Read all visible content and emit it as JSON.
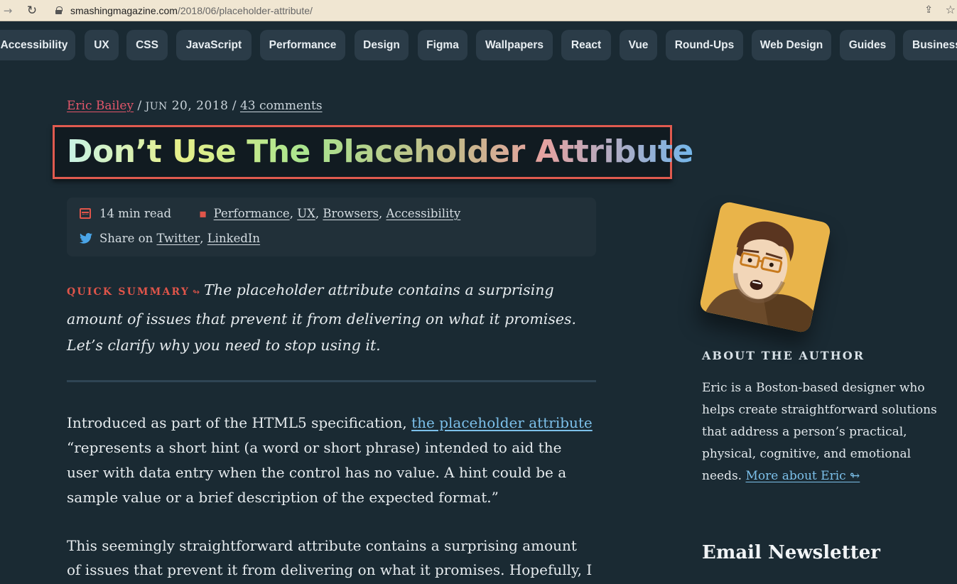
{
  "browser": {
    "back_glyph": "→",
    "reload_glyph": "↻",
    "url_host": "smashingmagazine.com",
    "url_path": "/2018/06/placeholder-attribute/",
    "share_glyph": "⇪",
    "star_glyph": "☆"
  },
  "categories": [
    "Accessibility",
    "UX",
    "CSS",
    "JavaScript",
    "Performance",
    "Design",
    "Figma",
    "Wallpapers",
    "React",
    "Vue",
    "Round-Ups",
    "Web Design",
    "Guides",
    "Business"
  ],
  "article": {
    "author": "Eric Bailey",
    "separator": "/",
    "date_month": "JUN",
    "date_rest": "20, 2018",
    "comments": "43 comments",
    "title": "Don’t Use The Placeholder Attribute",
    "read_time": "14 min read",
    "tags": [
      "Performance",
      "UX",
      "Browsers",
      "Accessibility"
    ],
    "share_prefix": "Share on",
    "share_links": [
      "Twitter",
      "LinkedIn"
    ],
    "summary_label": "QUICK SUMMARY",
    "summary_arrow": "↬",
    "summary_text": "The placeholder attribute contains a surprising amount of issues that prevent it from delivering on what it promises. Let’s clarify why you need to stop using it.",
    "p1_before": "Introduced as part of the HTML5 specification, ",
    "p1_link": "the placeholder attribute",
    "p1_after": "“represents a short hint (a word or short phrase) intended to aid the user with data entry when the control has no value. A hint could be a sample value or a brief description of the expected format.”",
    "p2": "This seemingly straightforward attribute contains a surprising amount of issues that prevent it from delivering on what it promises. Hopefully, I can convince you to stop"
  },
  "sidebar": {
    "about_heading": "ABOUT THE AUTHOR",
    "about_text": "Eric is a Boston-based designer who helps create straightforward solutions that address a person’s practical, physical, cognitive, and emotional needs. ",
    "more_link": "More about Eric ↬",
    "newsletter_heading": "Email Newsletter"
  },
  "colors": {
    "background": "#1a2a33",
    "accent": "#e0554a",
    "link": "#7cc0ea",
    "pill": "#2b3c48"
  }
}
